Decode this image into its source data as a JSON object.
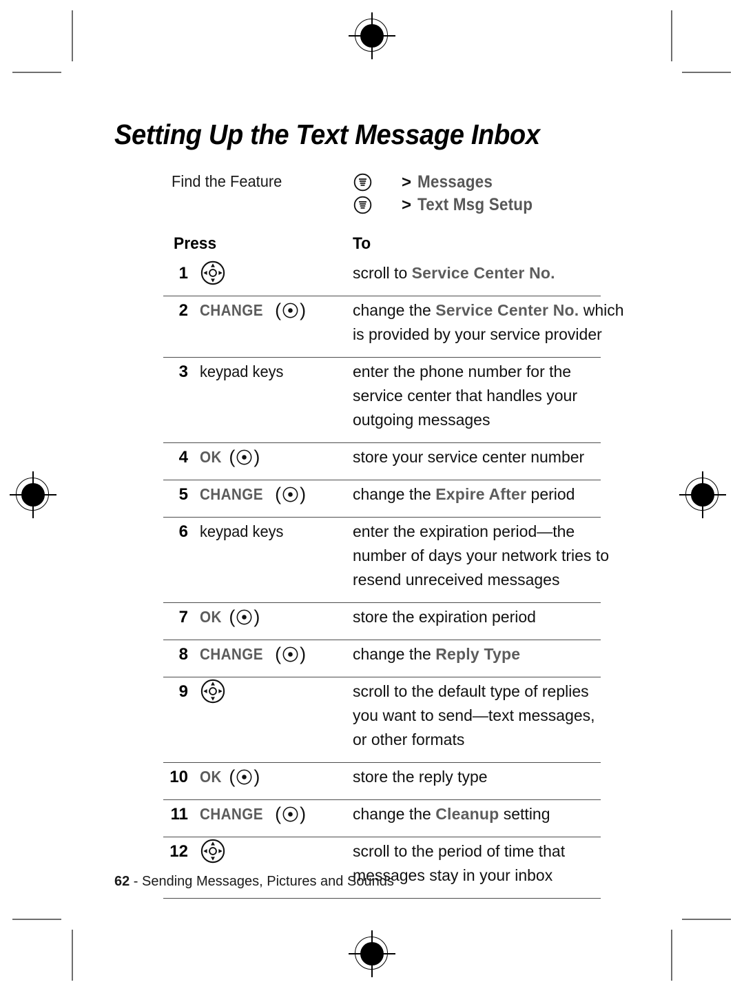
{
  "title": "Setting Up the Text Message Inbox",
  "find_the_feature": {
    "label": "Find the Feature",
    "rows": [
      {
        "icon": "menu-key-icon",
        "arrow": ">",
        "name": "Messages"
      },
      {
        "icon": "menu-key-icon",
        "arrow": ">",
        "name": "Text Msg Setup"
      }
    ]
  },
  "table": {
    "headers": {
      "press": "Press",
      "to": "To"
    },
    "rows": [
      {
        "num": "1",
        "press": {
          "type": "nav",
          "icon": "four-way-navigation-key-icon"
        },
        "to": [
          [
            {
              "t": "scroll to "
            },
            {
              "t": "Service Center No.",
              "ui": true
            }
          ]
        ]
      },
      {
        "num": "2",
        "press": {
          "type": "softkey",
          "label": "CHANGE",
          "icon": "center-select-key-icon"
        },
        "to": [
          [
            {
              "t": "change the "
            },
            {
              "t": "Service Center No.",
              "ui": true
            },
            {
              "t": " which"
            }
          ],
          [
            {
              "t": "is provided by your service provider"
            }
          ]
        ]
      },
      {
        "num": "3",
        "press": {
          "type": "plain",
          "label": "keypad keys"
        },
        "to": [
          [
            {
              "t": "enter the phone number for the"
            }
          ],
          [
            {
              "t": "service center that handles your"
            }
          ],
          [
            {
              "t": "outgoing messages"
            }
          ]
        ]
      },
      {
        "num": "4",
        "press": {
          "type": "softkey",
          "label": "OK",
          "icon": "center-select-key-icon"
        },
        "to": [
          [
            {
              "t": "store your service center number"
            }
          ]
        ]
      },
      {
        "num": "5",
        "press": {
          "type": "softkey",
          "label": "CHANGE",
          "icon": "center-select-key-icon"
        },
        "to": [
          [
            {
              "t": "change the "
            },
            {
              "t": "Expire After",
              "ui": true
            },
            {
              "t": " period"
            }
          ]
        ]
      },
      {
        "num": "6",
        "press": {
          "type": "plain",
          "label": "keypad keys"
        },
        "to": [
          [
            {
              "t": "enter the expiration period—the"
            }
          ],
          [
            {
              "t": "number of days your network tries to"
            }
          ],
          [
            {
              "t": "resend unreceived messages"
            }
          ]
        ]
      },
      {
        "num": "7",
        "press": {
          "type": "softkey",
          "label": "OK",
          "icon": "center-select-key-icon"
        },
        "to": [
          [
            {
              "t": "store the expiration period"
            }
          ]
        ]
      },
      {
        "num": "8",
        "press": {
          "type": "softkey",
          "label": "CHANGE",
          "icon": "center-select-key-icon"
        },
        "to": [
          [
            {
              "t": "change the "
            },
            {
              "t": "Reply Type",
              "ui": true
            }
          ]
        ]
      },
      {
        "num": "9",
        "press": {
          "type": "nav",
          "icon": "four-way-navigation-key-icon"
        },
        "to": [
          [
            {
              "t": "scroll to the default type of replies"
            }
          ],
          [
            {
              "t": "you want to send—text messages,"
            }
          ],
          [
            {
              "t": "or other formats"
            }
          ]
        ]
      },
      {
        "num": "10",
        "press": {
          "type": "softkey",
          "label": "OK",
          "icon": "center-select-key-icon"
        },
        "to": [
          [
            {
              "t": "store the reply type"
            }
          ]
        ]
      },
      {
        "num": "11",
        "press": {
          "type": "softkey",
          "label": "CHANGE",
          "icon": "center-select-key-icon"
        },
        "to": [
          [
            {
              "t": "change the "
            },
            {
              "t": "Cleanup",
              "ui": true
            },
            {
              "t": " setting"
            }
          ]
        ]
      },
      {
        "num": "12",
        "press": {
          "type": "nav",
          "icon": "four-way-navigation-key-icon"
        },
        "to": [
          [
            {
              "t": "scroll to the period of time that"
            }
          ],
          [
            {
              "t": "messages stay in your inbox"
            }
          ]
        ]
      }
    ]
  },
  "footer": {
    "page_number": "62",
    "separator": " - ",
    "section": "Sending Messages, Pictures and Sounds"
  },
  "colors": {
    "text": "#111111",
    "ui_label_gray": "#5c5c5c",
    "rule": "#4c4c4c",
    "crop_mark": "#6e6e6e"
  }
}
